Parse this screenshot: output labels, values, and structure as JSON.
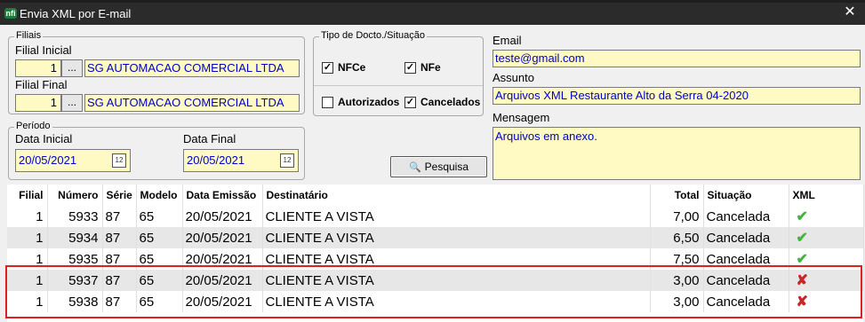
{
  "window": {
    "title": "Envia XML por E-mail",
    "close_glyph": "✕",
    "app_icon_text": "nfi"
  },
  "filiais": {
    "legend": "Filiais",
    "inicial": {
      "label": "Filial Inicial",
      "code": "1",
      "ellipsis": "...",
      "name": "SG AUTOMACAO COMERCIAL LTDA"
    },
    "final": {
      "label": "Filial Final",
      "code": "1",
      "ellipsis": "...",
      "name": "SG AUTOMACAO COMERCIAL LTDA"
    }
  },
  "periodo": {
    "legend": "Período",
    "inicial": {
      "label": "Data Inicial",
      "value": "20/05/2021"
    },
    "final": {
      "label": "Data Final",
      "value": "20/05/2021"
    }
  },
  "tipo": {
    "legend": "Tipo de Docto./Situação",
    "nfce": {
      "label": "NFCe",
      "checked": true
    },
    "nfe": {
      "label": "NFe",
      "checked": true
    },
    "autorizados": {
      "label": "Autorizados",
      "checked": false
    },
    "cancelados": {
      "label": "Cancelados",
      "checked": true
    },
    "check_glyph": "✓"
  },
  "pesquisa": {
    "label": "Pesquisa",
    "icon": "magnifier-icon",
    "icon_glyph": "🔍"
  },
  "email": {
    "label": "Email",
    "value": "teste@gmail.com"
  },
  "assunto": {
    "label": "Assunto",
    "value": "Arquivos XML Restaurante Alto da Serra 04-2020"
  },
  "mensagem": {
    "label": "Mensagem",
    "value": "Arquivos em anexo."
  },
  "grid": {
    "headers": [
      "Filial",
      "Número",
      "Série",
      "Modelo",
      "Data Emissão",
      "Destinatário",
      "Total",
      "Situação",
      "XML"
    ],
    "rows": [
      {
        "filial": "1",
        "numero": "5933",
        "serie": "87",
        "modelo": "65",
        "data": "20/05/2021",
        "destinatario": "CLIENTE A VISTA",
        "total": "7,00",
        "situacao": "Cancelada",
        "xml": "✔"
      },
      {
        "filial": "1",
        "numero": "5934",
        "serie": "87",
        "modelo": "65",
        "data": "20/05/2021",
        "destinatario": "CLIENTE A VISTA",
        "total": "6,50",
        "situacao": "Cancelada",
        "xml": "✔"
      },
      {
        "filial": "1",
        "numero": "5935",
        "serie": "87",
        "modelo": "65",
        "data": "20/05/2021",
        "destinatario": "CLIENTE A VISTA",
        "total": "7,50",
        "situacao": "Cancelada",
        "xml": "✔"
      },
      {
        "filial": "1",
        "numero": "5937",
        "serie": "87",
        "modelo": "65",
        "data": "20/05/2021",
        "destinatario": "CLIENTE A VISTA",
        "total": "3,00",
        "situacao": "Cancelada",
        "xml": "✘"
      },
      {
        "filial": "1",
        "numero": "5938",
        "serie": "87",
        "modelo": "65",
        "data": "20/05/2021",
        "destinatario": "CLIENTE A VISTA",
        "total": "3,00",
        "situacao": "Cancelada",
        "xml": "✘"
      }
    ]
  },
  "colors": {
    "field_bg": "#fff9c4",
    "field_text": "#0000cc",
    "highlight": "#e0201e",
    "ok": "#3cb83c",
    "bad": "#c62828"
  }
}
